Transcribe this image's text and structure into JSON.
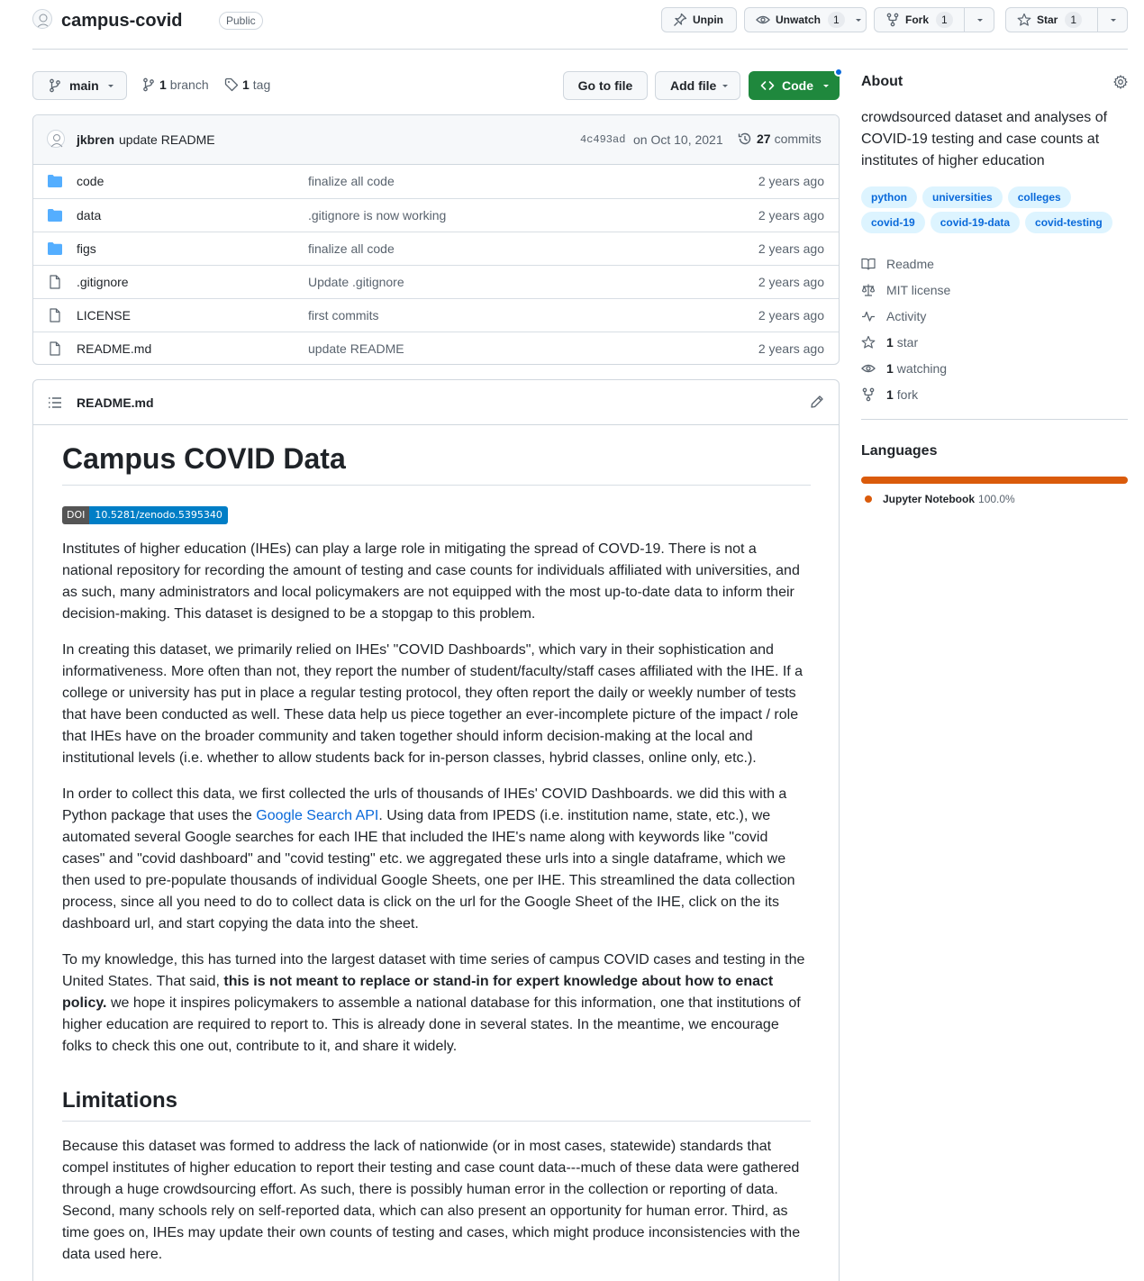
{
  "repo": {
    "name": "campus-covid",
    "visibility": "Public",
    "actions": {
      "pin_label": "Unpin",
      "watch_label": "Unwatch",
      "watch_count": "1",
      "fork_label": "Fork",
      "fork_count": "1",
      "star_label": "Star",
      "star_count": "1"
    }
  },
  "toolbar": {
    "branch": "main",
    "branches_count": "1",
    "branches_label": "branch",
    "tags_count": "1",
    "tags_label": "tag",
    "go_to_file": "Go to file",
    "add_file": "Add file",
    "code": "Code"
  },
  "latest_commit": {
    "author": "jkbren",
    "message": "update README",
    "sha": "4c493ad",
    "date": "on Oct 10, 2021",
    "commits_count": "27",
    "commits_label": "commits"
  },
  "files": [
    {
      "name": "code",
      "type": "folder",
      "message": "finalize all code",
      "age": "2 years ago"
    },
    {
      "name": "data",
      "type": "folder",
      "message": ".gitignore is now working",
      "age": "2 years ago"
    },
    {
      "name": "figs",
      "type": "folder",
      "message": "finalize all code",
      "age": "2 years ago"
    },
    {
      "name": ".gitignore",
      "type": "file",
      "message": "Update .gitignore",
      "age": "2 years ago"
    },
    {
      "name": "LICENSE",
      "type": "file",
      "message": "first commits",
      "age": "2 years ago"
    },
    {
      "name": "README.md",
      "type": "file",
      "message": "update README",
      "age": "2 years ago"
    }
  ],
  "readme": {
    "filename": "README.md",
    "title": "Campus COVID Data",
    "badge_label": "DOI",
    "badge_value": "10.5281/zenodo.5395340",
    "p1": "Institutes of higher education (IHEs) can play a large role in mitigating the spread of COVD-19. There is not a national repository for recording the amount of testing and case counts for individuals affiliated with universities, and as such, many administrators and local policymakers are not equipped with the most up-to-date data to inform their decision-making. This dataset is designed to be a stopgap to this problem.",
    "p2": "In creating this dataset, we primarily relied on IHEs' \"COVID Dashboards\", which vary in their sophistication and informativeness. More often than not, they report the number of student/faculty/staff cases affiliated with the IHE. If a college or university has put in place a regular testing protocol, they often report the daily or weekly number of tests that have been conducted as well. These data help us piece together an ever-incomplete picture of the impact / role that IHEs have on the broader community and taken together should inform decision-making at the local and institutional levels (i.e. whether to allow students back for in-person classes, hybrid classes, online only, etc.).",
    "p3_a": "In order to collect this data, we first collected the urls of thousands of IHEs' COVID Dashboards. we did this with a Python package that uses the ",
    "p3_link": "Google Search API",
    "p3_b": ". Using data from IPEDS (i.e. institution name, state, etc.), we automated several Google searches for each IHE that included the IHE's name along with keywords like \"covid cases\" and \"covid dashboard\" and \"covid testing\" etc. we aggregated these urls into a single dataframe, which we then used to pre-populate thousands of individual Google Sheets, one per IHE. This streamlined the data collection process, since all you need to do to collect data is click on the url for the Google Sheet of the IHE, click on the its dashboard url, and start copying the data into the sheet.",
    "p4_a": "To my knowledge, this has turned into the largest dataset with time series of campus COVID cases and testing in the United States. That said, ",
    "p4_bold": "this is not meant to replace or stand-in for expert knowledge about how to enact policy.",
    "p4_b": " we hope it inspires policymakers to assemble a national database for this information, one that institutions of higher education are required to report to. This is already done in several states. In the meantime, we encourage folks to check this one out, contribute to it, and share it widely.",
    "h2": "Limitations",
    "p5": "Because this dataset was formed to address the lack of nationwide (or in most cases, statewide) standards that compel institutes of higher education to report their testing and case count data---much of these data were gathered through a huge crowdsourcing effort. As such, there is possibly human error in the collection or reporting of data. Second, many schools rely on self-reported data, which can also present an opportunity for human error. Third, as time goes on, IHEs may update their own counts of testing and cases, which might produce inconsistencies with the data used here."
  },
  "about": {
    "title": "About",
    "description": "crowdsourced dataset and analyses of COVID-19 testing and case counts at institutes of higher education",
    "topics": [
      "python",
      "universities",
      "colleges",
      "covid-19",
      "covid-19-data",
      "covid-testing"
    ],
    "readme": "Readme",
    "license": "MIT license",
    "activity": "Activity",
    "stars_count": "1",
    "stars_label": "star",
    "watching_count": "1",
    "watching_label": "watching",
    "forks_count": "1",
    "forks_label": "fork"
  },
  "languages": {
    "title": "Languages",
    "items": [
      {
        "name": "Jupyter Notebook",
        "percent": "100.0%",
        "fraction": 1.0,
        "color": "#da5b0b"
      }
    ]
  }
}
